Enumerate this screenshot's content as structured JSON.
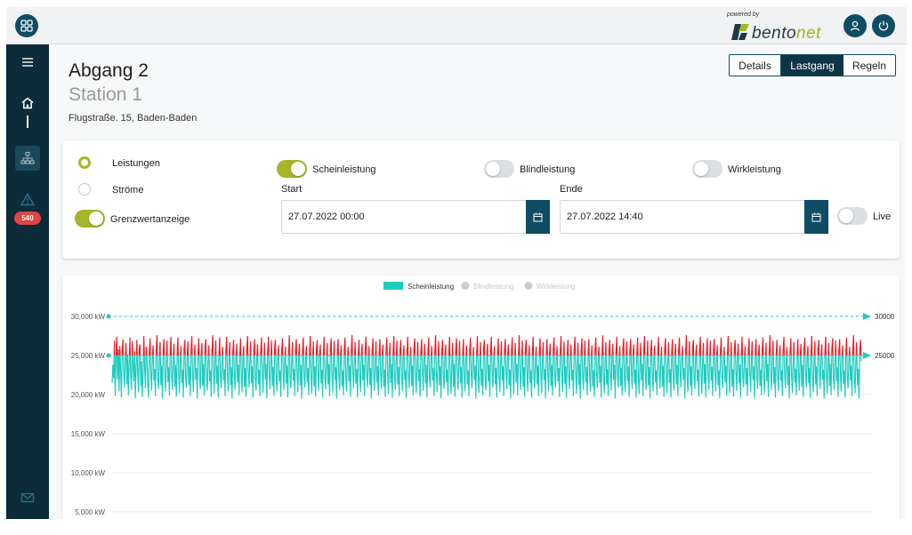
{
  "brand": {
    "powered_by": "powered by",
    "word_main": "bento",
    "word_accent": "net"
  },
  "header": {
    "title": "Abgang 2",
    "subtitle": "Station 1",
    "address": "Flugstraße. 15, Baden-Baden"
  },
  "tabs": [
    {
      "label": "Details",
      "active": false
    },
    {
      "label": "Lastgang",
      "active": true
    },
    {
      "label": "Regeln",
      "active": false
    }
  ],
  "sidebar": {
    "alarm_badge": "540"
  },
  "filters": {
    "radio_leistungen": "Leistungen",
    "radio_stroeme": "Ströme",
    "grenzwert_label": "Grenzwertanzeige",
    "schein_label": "Scheinleistung",
    "blind_label": "Blindleistung",
    "wirk_label": "Wirkleistung",
    "start_label": "Start",
    "start_value": "27.07.2022 00:00",
    "ende_label": "Ende",
    "ende_value": "27.07.2022 14:40",
    "live_label": "Live"
  },
  "colors": {
    "primary": "#0e4d63",
    "sidebar": "#0b2c38",
    "accent": "#a6b52a",
    "series": "#1ecbc0",
    "over_limit": "#e8202a"
  },
  "chart_data": {
    "type": "line",
    "legend": [
      {
        "name": "Scheinleistung",
        "active": true
      },
      {
        "name": "Blindleistung",
        "active": false
      },
      {
        "name": "Wirkleistung",
        "active": false
      }
    ],
    "legend_position": "top-center",
    "y_ticks": [
      "30,000 kW",
      "25,000 kW",
      "20,000 kW",
      "15,000 kW",
      "10,000 kW",
      "5,000 kW"
    ],
    "y_tick_values": [
      30000,
      25000,
      20000,
      15000,
      10000,
      5000
    ],
    "ylim": [
      5000,
      30000
    ],
    "thresholds": [
      {
        "value": 30000,
        "label": "30000"
      },
      {
        "value": 25000,
        "label": "25000"
      }
    ],
    "grid": true,
    "series_name": "Scheinleistung",
    "values": [
      21500,
      23800,
      22100,
      26900,
      19800,
      24600,
      27400,
      21900,
      25800,
      20400,
      26200,
      23100,
      19600,
      25400,
      27100,
      22700,
      20900,
      24800,
      26600,
      21300,
      25100,
      19900,
      23900,
      27300,
      22400,
      20600,
      26800,
      24100,
      21700,
      25600,
      19500,
      23400,
      27000,
      22900,
      20300,
      25900,
      26400,
      21100,
      24300,
      19700,
      22800,
      27500,
      23600,
      20800,
      26100,
      24900,
      21400,
      19600,
      25300,
      27200,
      22600,
      20500,
      24700,
      26300,
      21800,
      23300,
      19800,
      25700,
      27600,
      22200,
      20700,
      24400,
      26700,
      21200,
      23700,
      19500,
      25500,
      27100,
      22500,
      20400,
      24200,
      26900,
      21600,
      23500,
      19900,
      25200,
      27400,
      22300,
      20600,
      24600,
      26500,
      21000,
      23800,
      19700,
      25000,
      27300,
      22800,
      20200,
      24500,
      26200,
      21500,
      23200,
      19600,
      25800,
      27000,
      22100,
      20900,
      24800,
      26800,
      21300,
      23600,
      19800,
      25600,
      27500,
      22700,
      20300,
      24100,
      26400,
      21900,
      23400,
      19500,
      25300,
      27200,
      22400,
      20700,
      24900,
      26600,
      21100,
      23900,
      19900,
      25900,
      27100,
      22000,
      20500,
      24300,
      26300,
      21700,
      23100,
      19700,
      25400,
      27600,
      22900,
      20100,
      24700,
      26900,
      21400,
      23700,
      19600,
      25100,
      27300,
      22200,
      20800,
      24500,
      26100,
      21800,
      23300,
      19800,
      25700,
      27400,
      22600,
      20400,
      24200,
      26700,
      21200,
      23500,
      19500,
      25500,
      27000,
      22300,
      20600,
      24800,
      26500,
      21600,
      23800,
      19900,
      25000,
      27200,
      22500,
      20300,
      24600,
      26200,
      21000,
      23400,
      19700,
      25800,
      27500,
      22800,
      20900,
      24400,
      26800,
      21500,
      23600,
      19600,
      25200,
      27100,
      22100,
      20500,
      24900,
      26400,
      21300,
      23200,
      19800,
      25600,
      27300,
      22700,
      20200,
      24100,
      26600,
      21900,
      23900,
      19500,
      25300,
      27400,
      22400,
      20700,
      24300,
      26900,
      21100,
      23500,
      19900,
      25900,
      27000,
      22000,
      20400,
      24700,
      26300,
      21700,
      23100,
      19700,
      25400,
      27200,
      22900,
      20600,
      24500,
      26100,
      21400,
      23700,
      19600,
      25100,
      27600,
      22200,
      20800,
      24200,
      26700,
      21800,
      23300,
      19800,
      25700,
      27100,
      22600,
      20300,
      24800,
      26500,
      21200,
      23800,
      19500,
      25500,
      27300,
      22300,
      20900,
      24600,
      26200,
      21600,
      23400,
      19900,
      25000,
      27500,
      22500,
      20100,
      24400,
      26800,
      21000,
      23600,
      19700,
      25800,
      27000,
      22800,
      20500,
      24900,
      26400,
      21500,
      23200,
      19600,
      25200,
      27400,
      22100,
      20700,
      24100,
      26600,
      21300,
      23900,
      19800,
      25600,
      27200,
      22700,
      20200,
      24300,
      26900,
      21900,
      23500,
      19500,
      25300,
      27100,
      22400,
      20600,
      24700,
      26300,
      21100,
      23100,
      19900,
      25900,
      27300,
      22000,
      20400,
      24500,
      26100,
      21700,
      23700,
      19700,
      25400,
      27600,
      22900,
      20800,
      24200,
      26700,
      21400,
      23300,
      19600,
      25100,
      27000,
      22200,
      20300,
      24800,
      26500,
      21800,
      23800,
      19800,
      25700,
      27400,
      22600,
      20900,
      24600,
      26200,
      21200,
      23400,
      19500,
      25500,
      27200,
      22300,
      20500,
      24400,
      26800,
      21600,
      23600,
      19900,
      25000,
      27100,
      22500,
      20700,
      24900,
      26400,
      21000,
      23200,
      19700,
      25800,
      27300,
      22800,
      20100,
      24100,
      26600,
      21500,
      23900,
      19600,
      25200,
      27500,
      22100,
      20600,
      24300,
      26900,
      21300,
      23500,
      19800,
      25600,
      27000,
      22700,
      20400,
      24700,
      26300,
      21900,
      23100,
      19500,
      25300,
      27400,
      22400,
      20800,
      24500,
      26100,
      21100,
      23700,
      19900,
      25900,
      27200,
      22000,
      20200,
      24200,
      26700,
      21700,
      23300,
      19700,
      25400,
      27100,
      22900,
      20500,
      24800,
      26500,
      21400,
      23800,
      19600,
      25100,
      27300,
      22200,
      20900,
      24600,
      26200,
      21800,
      23400,
      19800,
      25700,
      27600,
      22600,
      20300,
      24400,
      26800,
      21200,
      23600,
      19500,
      25500,
      27000,
      22300,
      20700,
      24900,
      26400,
      21600,
      23200,
      19900,
      25000,
      27400,
      22500,
      20100,
      24100,
      26600,
      21000,
      23900,
      19700,
      25800,
      27200,
      22800,
      20600,
      24300,
      26900,
      21500,
      23500,
      19600,
      25200,
      27100,
      22100,
      20400,
      24700,
      26300,
      21300,
      23100,
      19800,
      25600,
      27300,
      22700,
      20800,
      24500,
      26100,
      21900,
      23700,
      19500,
      25300,
      27500,
      22400,
      20200,
      24200,
      26700,
      21100,
      23300,
      19900,
      25900,
      27000,
      22000,
      20500,
      24800,
      26500,
      21700,
      23800,
      19700,
      25400,
      27400,
      22900,
      20900,
      24600,
      26200,
      21400,
      23400,
      19600,
      25100,
      27200,
      22200,
      20300,
      24400,
      26800,
      21800,
      23600,
      19800,
      25700,
      27100,
      22600,
      20700,
      24900,
      26400,
      21200,
      23200,
      19500,
      25500,
      27300,
      22300,
      20100,
      24100,
      26600,
      21600,
      23900,
      19900,
      25000,
      27600,
      22500,
      20600,
      24300,
      26900,
      21000,
      23500,
      19700,
      25800,
      27000,
      22800,
      20400,
      24700,
      26300,
      21500,
      23100,
      19600,
      25200,
      27400,
      22100,
      20800,
      24500,
      26100,
      21300,
      23700,
      19800,
      25600,
      27200,
      22700,
      20200,
      24200,
      26700,
      21900,
      23300,
      19500,
      25300,
      27100,
      22400,
      20500,
      24800,
      26500,
      21100,
      23800,
      19900,
      25900,
      27300,
      22000,
      20900,
      24600,
      26200,
      21700,
      23400,
      19700,
      25400,
      27500,
      22900,
      20300,
      24400,
      26800,
      21400,
      23600,
      19600,
      25100,
      27000,
      22200,
      20700,
      24900,
      26400,
      21800,
      23200,
      19800,
      25700,
      27400,
      22600,
      20100,
      24100,
      26600,
      21200,
      23900,
      19500,
      25500,
      27200,
      22300,
      20600,
      24300,
      26900,
      21600,
      23500,
      19900,
      25000,
      27100,
      22500,
      20400,
      24700,
      26300,
      21000,
      23100,
      19700,
      25800,
      27300,
      22800,
      20800,
      24500,
      26100,
      21500,
      23700,
      19600,
      25200,
      27600,
      22100,
      20200,
      24200,
      26700,
      21300,
      23300,
      19800,
      25600,
      27000,
      22700,
      20500,
      24800,
      26500,
      21900,
      23800,
      19500,
      25300,
      27400,
      22400,
      20900,
      24600,
      26200,
      21100,
      23400,
      19900,
      25900,
      27200,
      22000,
      20300,
      24400,
      26800,
      21700,
      23600,
      19700,
      25400,
      27100,
      22900,
      20700,
      24900,
      26400,
      21400,
      23200,
      19600,
      25100,
      27300,
      22200,
      20100,
      24100,
      26600,
      21800,
      23900,
      19800,
      25700,
      27500,
      22600,
      20600,
      24300,
      26900,
      21200,
      23500,
      19500,
      25500,
      27000,
      22300,
      20400,
      24700,
      26300,
      21600,
      23100,
      19900,
      25000,
      27400,
      22500,
      20800,
      24500,
      26100,
      21000,
      23700,
      19700,
      25800,
      27200,
      22800,
      20200,
      24200,
      26700,
      21500,
      23300,
      19600,
      25200,
      27100,
      22100,
      20500,
      24800,
      26500,
      21300,
      23800,
      19800,
      25600,
      27300,
      22700,
      20900,
      24600,
      26200,
      21900,
      23400,
      19500,
      25300,
      27600,
      22400,
      20300,
      24400,
      26800,
      21100,
      23600,
      19900,
      25900,
      27000,
      22000,
      20700,
      24900,
      26400,
      21700,
      23200,
      19700,
      25400,
      27400,
      22900,
      20100,
      24100,
      26600,
      21400,
      23900,
      19600,
      25100,
      27200,
      22200,
      20600,
      24300,
      26900,
      21800,
      23500,
      19800,
      25700,
      27100,
      22600,
      20400,
      24700,
      26300,
      21200,
      23100,
      19500,
      25500,
      27300,
      22300,
      20800,
      24500,
      26100,
      21600,
      23700,
      19900,
      25000,
      27500,
      22500,
      20200,
      24200,
      26700,
      21000,
      23300,
      19700,
      25800,
      27000,
      22800,
      20500,
      24800,
      26500,
      21500,
      23800,
      19600,
      25200,
      27400,
      22100,
      20900,
      24600,
      26200,
      21300,
      23400,
      19800,
      25600,
      27200,
      22700,
      20300,
      24400,
      26800,
      21900,
      23600,
      19500,
      25300,
      27100,
      22400,
      20700,
      24900,
      26400,
      21100,
      23200,
      19900,
      25900,
      27300,
      22000,
      20100,
      24100,
      26600,
      21700,
      23900,
      19700,
      25400,
      27600,
      22900,
      20600,
      24300,
      26900,
      21400,
      23500,
      19600,
      25100,
      27000,
      22200,
      20400,
      24700,
      26300,
      21800,
      23100,
      19800,
      25700,
      27400,
      22600,
      20800,
      24500,
      26100,
      21200,
      23700,
      19500,
      25500,
      27200,
      22300,
      20200,
      24200,
      26700,
      21600,
      23300,
      19900,
      25000,
      27100,
      22500,
      20500,
      24800,
      26500,
      21000,
      23800,
      19700,
      25800,
      27300,
      22800,
      20900,
      24600,
      26200,
      21500,
      23400,
      19600,
      25200,
      27500,
      22100,
      20300,
      24400,
      26800,
      21300,
      23600,
      19800,
      25600,
      27000,
      22700,
      20700,
      24900,
      26400,
      21900,
      23200,
      19500,
      25300,
      27400,
      22400,
      20100,
      24100,
      26600,
      21100,
      23900,
      19900,
      25900,
      27200,
      22000,
      20600,
      24300,
      26900,
      21700,
      23500,
      19700,
      25400,
      27100,
      22900,
      20400,
      24700,
      26300,
      21400,
      23100,
      19600,
      25100,
      27300,
      22200,
      20800,
      24500,
      26100,
      21800,
      23700,
      19800,
      25700,
      27600,
      22600,
      20200,
      24200,
      26700,
      21200,
      23300,
      19500,
      25500,
      27000,
      24300
    ]
  }
}
